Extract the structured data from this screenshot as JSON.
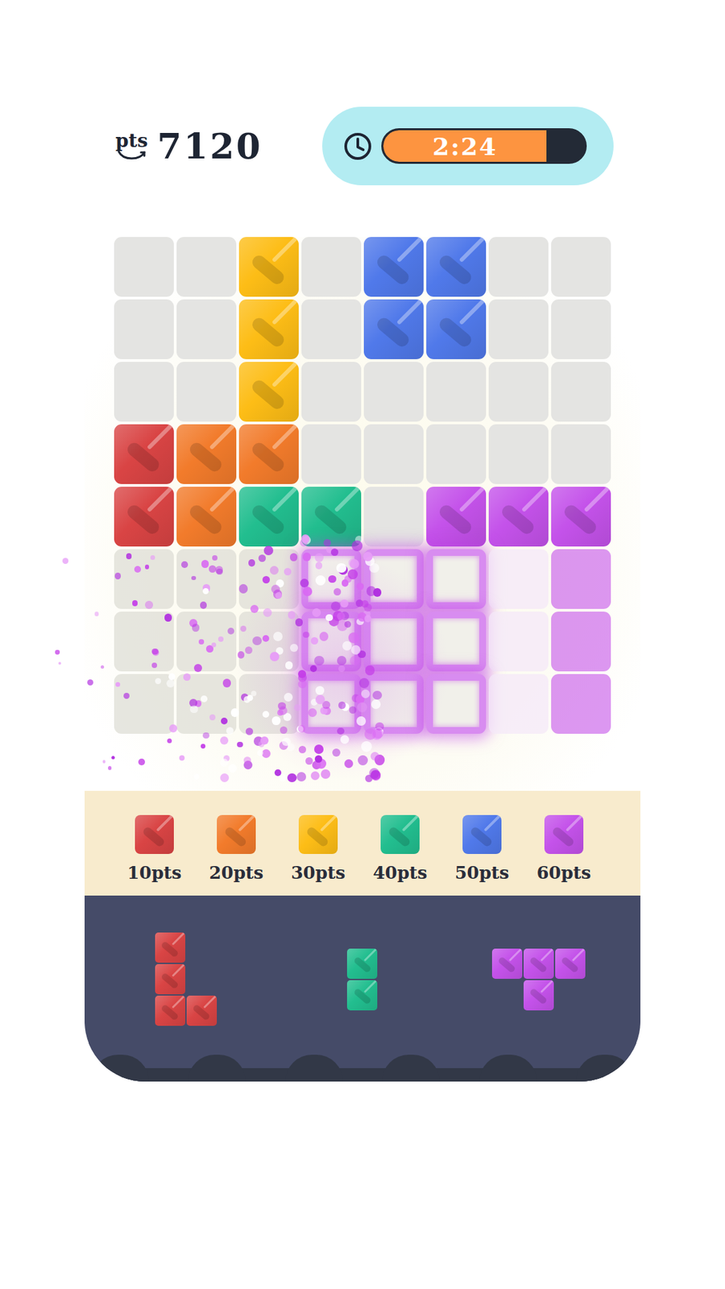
{
  "score": {
    "label": "pts",
    "value": "7120"
  },
  "timer": {
    "text": "2:24",
    "level": 0.81
  },
  "board": {
    "rows": [
      [
        {
          "kind": "empty"
        },
        {
          "kind": "empty"
        },
        {
          "kind": "block",
          "color": "#fdbd16"
        },
        {
          "kind": "empty"
        },
        {
          "kind": "block",
          "color": "#5079ea"
        },
        {
          "kind": "block",
          "color": "#5079ea"
        },
        {
          "kind": "empty"
        },
        {
          "kind": "empty"
        }
      ],
      [
        {
          "kind": "empty"
        },
        {
          "kind": "empty"
        },
        {
          "kind": "block",
          "color": "#fdbd16"
        },
        {
          "kind": "empty"
        },
        {
          "kind": "block",
          "color": "#5079ea"
        },
        {
          "kind": "block",
          "color": "#5079ea"
        },
        {
          "kind": "empty"
        },
        {
          "kind": "empty"
        }
      ],
      [
        {
          "kind": "empty"
        },
        {
          "kind": "empty"
        },
        {
          "kind": "block",
          "color": "#fdbd16"
        },
        {
          "kind": "empty"
        },
        {
          "kind": "empty"
        },
        {
          "kind": "empty"
        },
        {
          "kind": "empty"
        },
        {
          "kind": "empty"
        }
      ],
      [
        {
          "kind": "block",
          "color": "#d94444"
        },
        {
          "kind": "block",
          "color": "#f27b2b"
        },
        {
          "kind": "block",
          "color": "#f27b2b"
        },
        {
          "kind": "empty"
        },
        {
          "kind": "empty"
        },
        {
          "kind": "empty"
        },
        {
          "kind": "empty"
        },
        {
          "kind": "empty"
        }
      ],
      [
        {
          "kind": "block",
          "color": "#d94444"
        },
        {
          "kind": "block",
          "color": "#f27b2b"
        },
        {
          "kind": "block",
          "color": "#22be8f"
        },
        {
          "kind": "block",
          "color": "#22be8f"
        },
        {
          "kind": "empty"
        },
        {
          "kind": "block",
          "color": "#c452ea"
        },
        {
          "kind": "block",
          "color": "#c452ea"
        },
        {
          "kind": "block",
          "color": "#c452ea"
        }
      ],
      [
        {
          "kind": "dissolving"
        },
        {
          "kind": "dissolving"
        },
        {
          "kind": "dissolving"
        },
        {
          "kind": "glowing"
        },
        {
          "kind": "glowing"
        },
        {
          "kind": "glowing"
        },
        {
          "kind": "fading"
        },
        {
          "kind": "fading",
          "color": "#c452ea"
        }
      ],
      [
        {
          "kind": "dissolving"
        },
        {
          "kind": "dissolving"
        },
        {
          "kind": "dissolving"
        },
        {
          "kind": "glowing"
        },
        {
          "kind": "glowing"
        },
        {
          "kind": "glowing"
        },
        {
          "kind": "fading"
        },
        {
          "kind": "fading",
          "color": "#c452ea"
        }
      ],
      [
        {
          "kind": "dissolving"
        },
        {
          "kind": "dissolving"
        },
        {
          "kind": "dissolving"
        },
        {
          "kind": "glowing"
        },
        {
          "kind": "glowing"
        },
        {
          "kind": "glowing"
        },
        {
          "kind": "fading"
        },
        {
          "kind": "fading",
          "color": "#c452ea"
        }
      ]
    ]
  },
  "legend": [
    {
      "points": "10pts",
      "color": "#d94444"
    },
    {
      "points": "20pts",
      "color": "#f27b2b"
    },
    {
      "points": "30pts",
      "color": "#fdbd16"
    },
    {
      "points": "40pts",
      "color": "#22be8f"
    },
    {
      "points": "50pts",
      "color": "#5079ea"
    },
    {
      "points": "60pts",
      "color": "#c452ea"
    }
  ],
  "tray": [
    {
      "color": "#d94444",
      "shape": [
        [
          true,
          false
        ],
        [
          true,
          false
        ],
        [
          true,
          true
        ]
      ]
    },
    {
      "color": "#22be8f",
      "shape": [
        [
          true
        ],
        [
          true
        ]
      ]
    },
    {
      "color": "#c452ea",
      "shape": [
        [
          true,
          true,
          true
        ],
        [
          false,
          true,
          false
        ]
      ]
    }
  ]
}
